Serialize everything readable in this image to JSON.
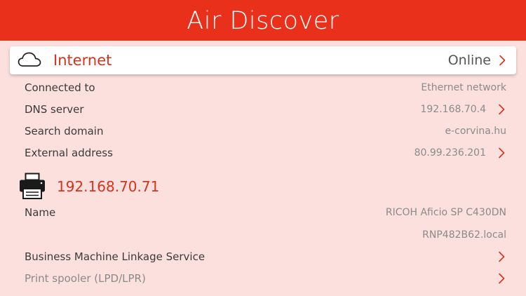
{
  "header": {
    "title": "Air Discover"
  },
  "internet": {
    "label": "Internet",
    "status": "Online",
    "icon": "cloud-icon"
  },
  "network_rows": [
    {
      "label": "Connected to",
      "value": "Ethernet network",
      "has_chevron": false
    },
    {
      "label": "DNS server",
      "value": "192.168.70.4",
      "has_chevron": true
    },
    {
      "label": "Search domain",
      "value": "e-corvina.hu",
      "has_chevron": false
    },
    {
      "label": "External address",
      "value": "80.99.236.201",
      "has_chevron": true
    }
  ],
  "printer": {
    "icon": "printer-icon",
    "ip": "192.168.70.71",
    "name_label": "Name",
    "name_value": "RICOH Aficio SP C430DN",
    "hostname": "RNP482B62.local",
    "services": [
      {
        "label": "Business Machine Linkage Service",
        "muted": false
      },
      {
        "label": "Print spooler (LPD/LPR)",
        "muted": true
      }
    ]
  },
  "colors": {
    "accent": "#e8301b",
    "background": "#fce0dd",
    "text": "#3a3a3a",
    "muted_text": "#8a8a8a",
    "chevron": "#d8321c"
  }
}
